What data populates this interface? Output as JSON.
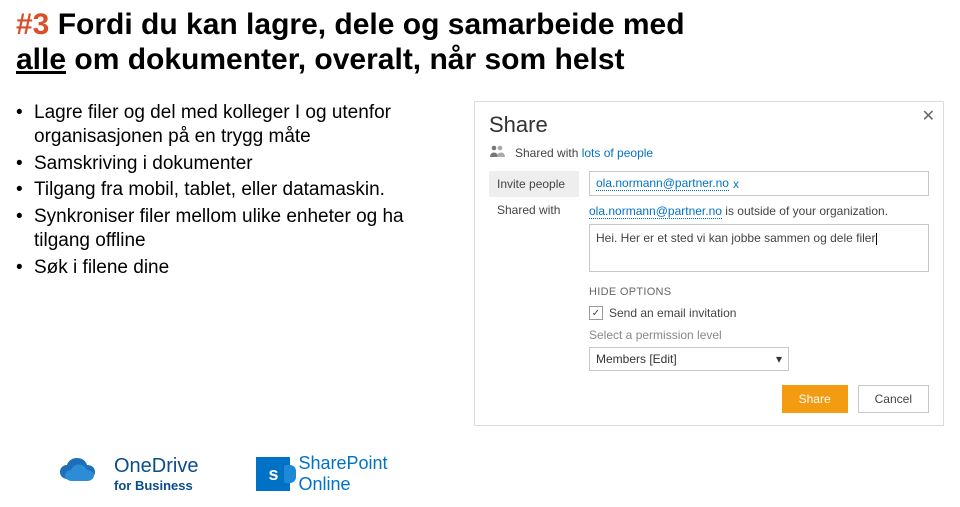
{
  "title": {
    "hash": "#3",
    "rest1": " Fordi du kan lagre, dele og samarbeide med ",
    "underlined": "alle",
    "rest2": " om dokumenter, overalt, når som helst"
  },
  "bullets": [
    "Lagre filer og del med kolleger I og utenfor organisasjonen på en trygg måte",
    "Samskriving i dokumenter",
    "Tilgang fra mobil, tablet, eller datamaskin.",
    "Synkroniser filer mellom ulike enheter og ha tilgang offline",
    "Søk i filene dine"
  ],
  "dialog": {
    "heading": "Share",
    "close": "✕",
    "shared_with_prefix": "Shared with ",
    "shared_with_link": "lots of people",
    "tabs": {
      "invite": "Invite people",
      "shared": "Shared with"
    },
    "recipient_email": "ola.normann@partner.no",
    "recipient_remove": "x",
    "external_email": "ola.normann@partner.no",
    "external_suffix": " is outside of your organization.",
    "message": "Hei. Her er et sted vi kan jobbe sammen og dele filer",
    "hide_options": "HIDE OPTIONS",
    "send_invitation": "Send an email invitation",
    "perm_label": "Select a permission level",
    "perm_value": "Members [Edit]",
    "buttons": {
      "share": "Share",
      "cancel": "Cancel"
    }
  },
  "logos": {
    "onedrive": {
      "line1": "OneDrive",
      "line2": "for Business"
    },
    "sharepoint": {
      "tile": "s",
      "line1": "SharePoint",
      "line2": "Online"
    }
  }
}
